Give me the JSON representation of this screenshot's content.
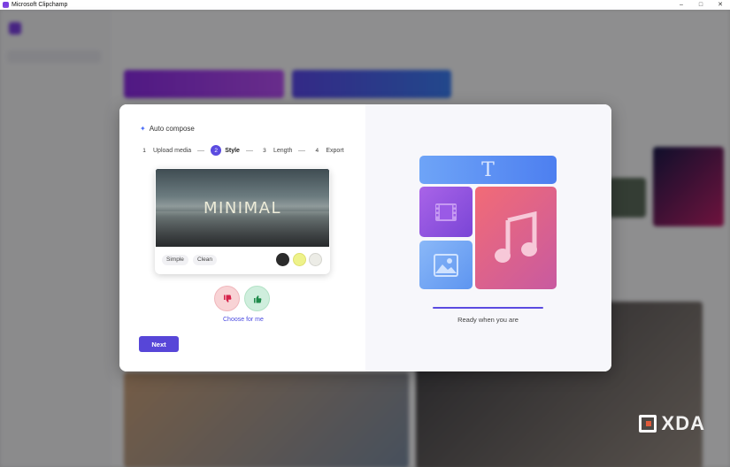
{
  "window": {
    "title": "Microsoft Clipchamp",
    "controls": [
      "–",
      "□",
      "✕"
    ]
  },
  "modal": {
    "title": "Auto compose",
    "steps": [
      {
        "num": "1",
        "label": "Upload media",
        "active": false
      },
      {
        "num": "2",
        "label": "Style",
        "active": true
      },
      {
        "num": "3",
        "label": "Length",
        "active": false
      },
      {
        "num": "4",
        "label": "Export",
        "active": false
      }
    ],
    "style_card": {
      "preview_text": "MINIMAL",
      "tags": [
        "Simple",
        "Clean"
      ],
      "swatches": [
        "#2b2b2b",
        "#eef28a",
        "#ecece6"
      ]
    },
    "choose_for_me": "Choose for me",
    "next_label": "Next",
    "ready_text": "Ready when you are",
    "illustration": {
      "text_tile_letter": "T",
      "colors": {
        "accent": "#5b4be0",
        "music": "#f26b76",
        "video": "#a964e8",
        "image": "#8ab8f8",
        "text": "#6ea4f7"
      }
    }
  },
  "watermark": {
    "text": "XDA"
  }
}
